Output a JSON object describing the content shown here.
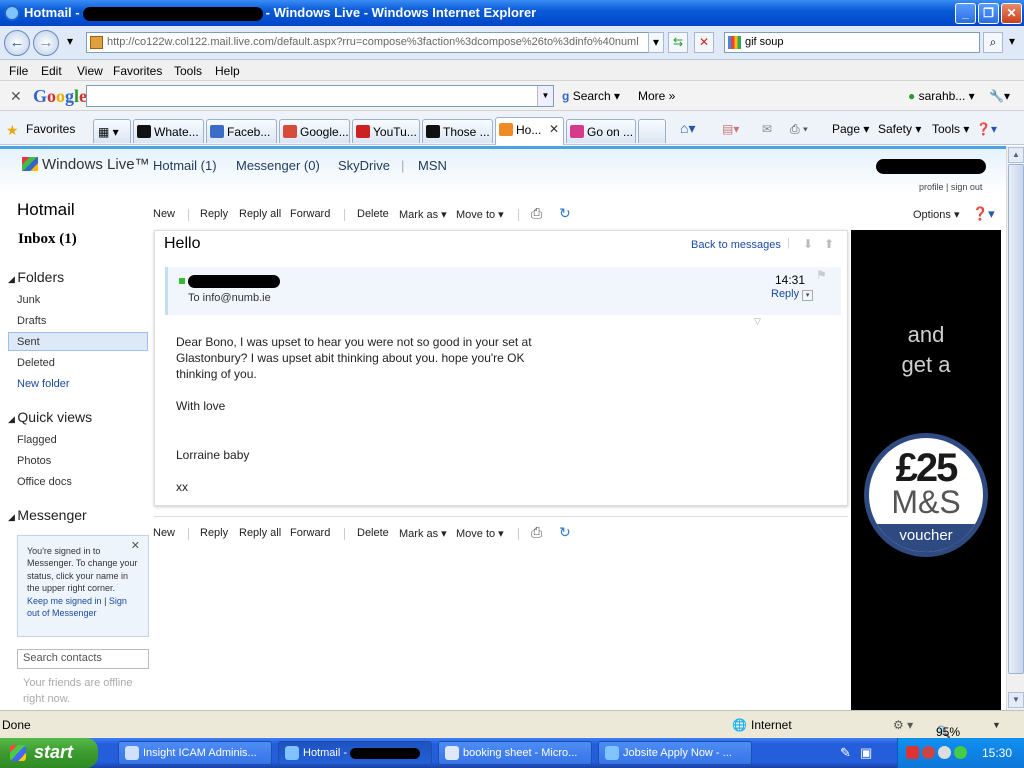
{
  "window": {
    "title_prefix": "Hotmail -",
    "title_suffix": "- Windows Live - Windows Internet Explorer",
    "min_label": "_",
    "max_label": "❐",
    "close_label": "✕"
  },
  "address": {
    "url": "http://co122w.col122.mail.live.com/default.aspx?rru=compose%3faction%3dcompose%26to%3dinfo%40numl",
    "search_value": "gif soup",
    "back_icon": "back-arrow-icon",
    "forward_icon": "forward-arrow-icon"
  },
  "menu": [
    "File",
    "Edit",
    "View",
    "Favorites",
    "Tools",
    "Help"
  ],
  "google_toolbar": {
    "logo": "Google",
    "search_label": "Search",
    "more_label": "More »",
    "account": "sarahb..."
  },
  "favorites_bar": {
    "label": "Favorites",
    "tabs": [
      {
        "label": "Whate...",
        "color": "#111111"
      },
      {
        "label": "Faceb...",
        "color": "#3b6cc8"
      },
      {
        "label": "Google...",
        "color": "#d84a3a"
      },
      {
        "label": "YouTu...",
        "color": "#cc2222"
      },
      {
        "label": "Those ...",
        "color": "#111111"
      },
      {
        "label": "Ho...",
        "color": "#f08a24"
      },
      {
        "label": "Go on ...",
        "color": "#d83a8a"
      }
    ],
    "commands": [
      "Page ▾",
      "Safety ▾",
      "Tools ▾"
    ]
  },
  "wl": {
    "logo": "Windows Live™",
    "nav": [
      "Hotmail (1)",
      "Messenger (0)",
      "SkyDrive",
      "|",
      "MSN"
    ],
    "profile_links": "profile | sign out"
  },
  "left_nav": {
    "app_title": "Hotmail",
    "inbox": "Inbox (1)",
    "folders_heading": "Folders",
    "folders": [
      "Junk",
      "Drafts",
      "Sent",
      "Deleted",
      "New folder"
    ],
    "quick_heading": "Quick views",
    "quick": [
      "Flagged",
      "Photos",
      "Office docs"
    ],
    "messenger_heading": "Messenger",
    "messenger_tip": "You're signed in to Messenger. To change your status, click your name in the upper right corner.",
    "keep_signed": "Keep me signed in",
    "sign_out_msgr": "Sign out of Messenger",
    "contacts_placeholder": "Search contacts",
    "offline_text": "Your friends are offline right now."
  },
  "toolbar": {
    "new": "New",
    "reply": "Reply",
    "reply_all": "Reply all",
    "forward": "Forward",
    "delete": "Delete",
    "mark_as": "Mark as ▾",
    "move_to": "Move to ▾",
    "options": "Options ▾"
  },
  "message": {
    "subject": "Hello",
    "back_link": "Back to messages",
    "to_line": "To info@numb.ie",
    "time": "14:31",
    "reply_link": "Reply",
    "body": [
      "Dear Bono, I was upset to hear you were not so good in your set at",
      "Glastonbury? I was upset abit thinking about you. hope you're OK",
      "thinking of you.",
      "",
      "With love",
      "",
      "",
      "Lorraine baby",
      "",
      "xx"
    ]
  },
  "ad": {
    "line1": "and",
    "line2": "get a",
    "amount": "£25",
    "brand": "M&S",
    "voucher": "voucher"
  },
  "status": {
    "left": "Done",
    "zone": "Internet",
    "zoom": "95%"
  },
  "taskbar": {
    "start": "start",
    "tasks": [
      "Insight ICAM Adminis...",
      "Hotmail -",
      "booking sheet - Micro...",
      "Jobsite Apply Now - ..."
    ],
    "clock": "15:30"
  }
}
